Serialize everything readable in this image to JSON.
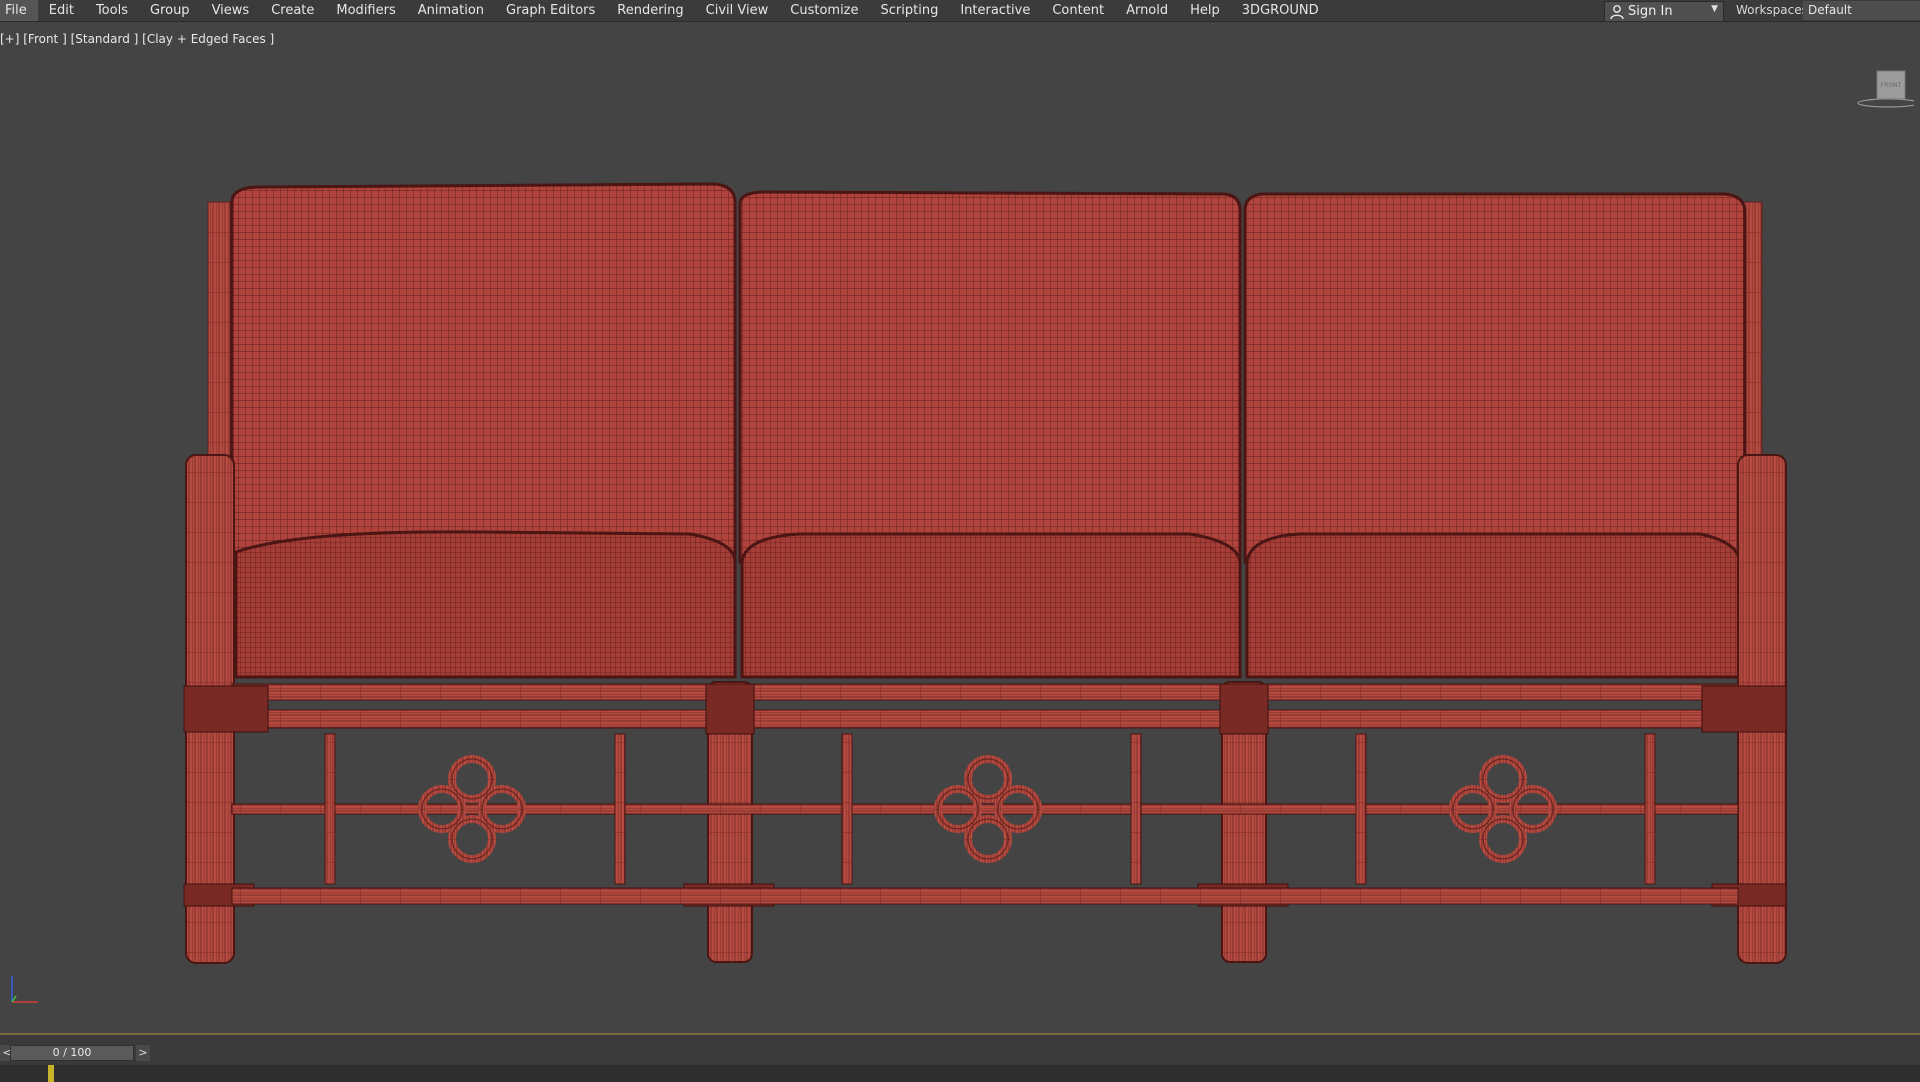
{
  "menu": {
    "items": [
      "File",
      "Edit",
      "Tools",
      "Group",
      "Views",
      "Create",
      "Modifiers",
      "Animation",
      "Graph Editors",
      "Rendering",
      "Civil View",
      "Customize",
      "Scripting",
      "Interactive",
      "Content",
      "Arnold",
      "Help",
      "3DGROUND"
    ]
  },
  "account": {
    "signin_label": "Sign In",
    "user_icon": "user-icon"
  },
  "workspace": {
    "label": "Workspaces:",
    "value": "Default"
  },
  "viewport": {
    "label": "[+] [Front ] [Standard ] [Clay + Edged Faces ]",
    "viewcube_face": "FRONT",
    "wire_color": "#7a2a24",
    "mesh_color": "#b0443c"
  },
  "timeline": {
    "frame_display": "0 / 100",
    "prev_label": "<",
    "next_label": ">"
  }
}
